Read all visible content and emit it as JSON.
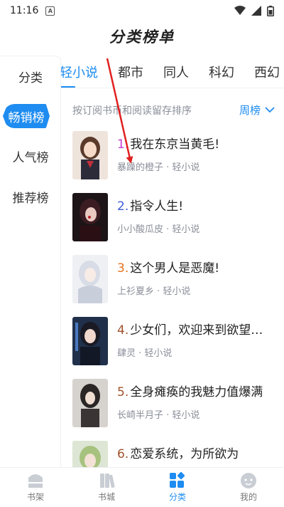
{
  "status_bar": {
    "time": "11:16",
    "notif_letter": "A"
  },
  "page_title": "分类榜单",
  "sidebar": {
    "label": "分类",
    "items": [
      {
        "label": "畅销榜",
        "active": true
      },
      {
        "label": "人气榜",
        "active": false
      },
      {
        "label": "推荐榜",
        "active": false
      }
    ]
  },
  "tabs": [
    {
      "label": "轻小说",
      "active": true
    },
    {
      "label": "都市",
      "active": false
    },
    {
      "label": "同人",
      "active": false
    },
    {
      "label": "科幻",
      "active": false
    },
    {
      "label": "西幻",
      "active": false
    }
  ],
  "subheader": {
    "hint": "按订阅书币和阅读留存排序",
    "sort_label": "周榜"
  },
  "books": [
    {
      "rank": "1.",
      "rank_color": "#c63bd1",
      "title": "我在东京当黄毛!",
      "meta": "暴躁的橙子 · 轻小说"
    },
    {
      "rank": "2.",
      "rank_color": "#3d5bd8",
      "title": "指令人生!",
      "meta": "小小酸瓜皮 · 轻小说"
    },
    {
      "rank": "3.",
      "rank_color": "#e8721d",
      "title": "这个男人是恶魔!",
      "meta": "上衫夏乡 · 轻小说"
    },
    {
      "rank": "4.",
      "rank_color": "#a0522d",
      "title": "少女们，欢迎来到欲望…",
      "meta": "肆灵 · 轻小说"
    },
    {
      "rank": "5.",
      "rank_color": "#a0522d",
      "title": "全身瘫痪的我魅力值爆满",
      "meta": "长崎半月子 · 轻小说"
    },
    {
      "rank": "6.",
      "rank_color": "#a0522d",
      "title": "恋爱系统，为所欲为",
      "meta": ""
    }
  ],
  "bottom_nav": [
    {
      "label": "书架",
      "icon": "bookshelf-icon",
      "active": false
    },
    {
      "label": "书城",
      "icon": "bookstore-icon",
      "active": false
    },
    {
      "label": "分类",
      "icon": "category-icon",
      "active": true
    },
    {
      "label": "我的",
      "icon": "profile-icon",
      "active": false
    }
  ],
  "colors": {
    "accent": "#1e8cf0",
    "annotation_arrow": "#e02020"
  }
}
